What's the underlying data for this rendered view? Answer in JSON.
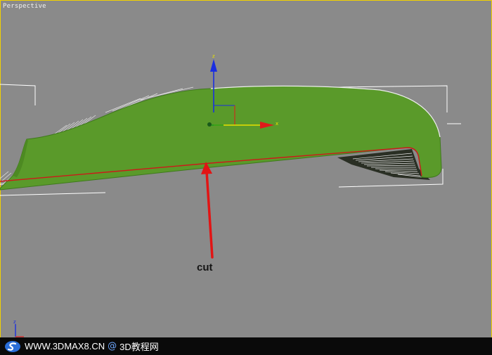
{
  "viewport": {
    "label": "Perspective",
    "background": "#8a8a8a",
    "active_border": "#f2d100"
  },
  "model": {
    "surface_color": "#5a9a2a",
    "cut_line_color": "#cc1a1a"
  },
  "gizmo": {
    "z_label": "z",
    "x_label": "x",
    "z_color": "#1a2ee0",
    "x_color": "#e01a1a",
    "y_color": "#1a9a1a",
    "plane_color": "#e8e000"
  },
  "annotation": {
    "text": "cut",
    "arrow_color": "#e21414"
  },
  "mini_axis": {
    "z_label": "z"
  },
  "watermark": {
    "site": "WWW.3DMAX8.CN",
    "at": "@",
    "brand": "3D教程网"
  }
}
